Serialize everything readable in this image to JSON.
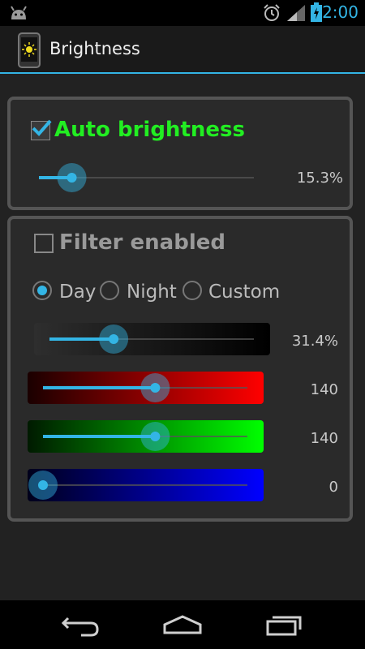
{
  "status_bar": {
    "time": "2:00",
    "battery_icon": "battery-charging-icon",
    "signal_icon": "signal-icon",
    "alarm_icon": "alarm-clock-icon",
    "app_icon": "android-icon"
  },
  "action_bar": {
    "title": "Brightness",
    "icon": "brightness-phone-icon"
  },
  "auto_brightness": {
    "label": "Auto brightness",
    "checked": true,
    "level": 15.3,
    "value_text": "15.3%",
    "label_color": "#22ee22"
  },
  "filter": {
    "label": "Filter enabled",
    "checked": false,
    "modes": [
      {
        "label": "Day",
        "selected": true
      },
      {
        "label": "Night",
        "selected": false
      },
      {
        "label": "Custom",
        "selected": false
      }
    ],
    "sliders": [
      {
        "name": "dim",
        "value_text": "31.4%",
        "value": 31.4,
        "max": 100
      },
      {
        "name": "red",
        "value_text": "140",
        "value": 140,
        "max": 255
      },
      {
        "name": "green",
        "value_text": "140",
        "value": 140,
        "max": 255
      },
      {
        "name": "blue",
        "value_text": "0",
        "value": 0,
        "max": 255
      }
    ]
  },
  "accent_color": "#33b5e5",
  "nav_bar": {
    "back_icon": "back-icon",
    "home_icon": "home-icon",
    "recents_icon": "recents-icon"
  }
}
